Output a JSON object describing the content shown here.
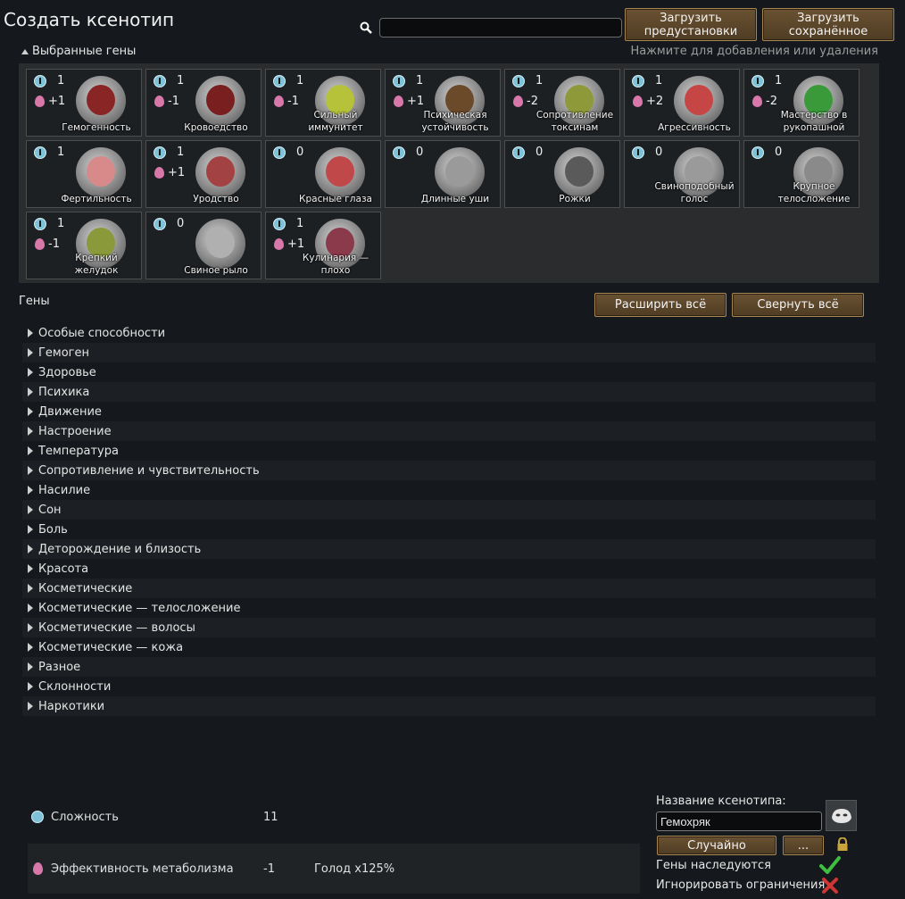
{
  "title": "Создать ксенотип",
  "search": {
    "value": ""
  },
  "buttons": {
    "load_presets": "Загрузить\nпредустановки",
    "load_saved": "Загрузить\nсохранённое",
    "expand_all": "Расширить всё",
    "collapse_all": "Свернуть всё",
    "random": "Случайно",
    "more": "..."
  },
  "selected": {
    "header": "Выбранные гены",
    "hint": "Нажмите для добавления или удаления",
    "genes": [
      {
        "label": "Гемогенность",
        "complexity": "1",
        "metabolism": "+1",
        "color": "#8a2525"
      },
      {
        "label": "Кровоедство",
        "complexity": "1",
        "metabolism": "-1",
        "color": "#7a1f1f"
      },
      {
        "label": "Сильный иммунитет",
        "complexity": "1",
        "metabolism": "-1",
        "color": "#b5c23a"
      },
      {
        "label": "Психическая устойчивость",
        "complexity": "1",
        "metabolism": "+1",
        "color": "#6b4a2a"
      },
      {
        "label": "Сопротивление токсинам",
        "complexity": "1",
        "metabolism": "-2",
        "color": "#8e9a3a"
      },
      {
        "label": "Агрессивность",
        "complexity": "1",
        "metabolism": "+2",
        "color": "#c64545"
      },
      {
        "label": "Мастерство в рукопашной",
        "complexity": "1",
        "metabolism": "-2",
        "color": "#3a9a3a"
      },
      {
        "label": "Фертильность",
        "complexity": "1",
        "metabolism": "",
        "color": "#d88a8a"
      },
      {
        "label": "Уродство",
        "complexity": "1",
        "metabolism": "+1",
        "color": "#a34242"
      },
      {
        "label": "Красные глаза",
        "complexity": "0",
        "metabolism": "",
        "color": "#c04848"
      },
      {
        "label": "Длинные уши",
        "complexity": "0",
        "metabolism": "",
        "color": "#9a9a9a"
      },
      {
        "label": "Рожки",
        "complexity": "0",
        "metabolism": "",
        "color": "#5a5a5a"
      },
      {
        "label": "Свиноподобный голос",
        "complexity": "0",
        "metabolism": "",
        "color": "#9a9a9a"
      },
      {
        "label": "Крупное телосложение",
        "complexity": "0",
        "metabolism": "",
        "color": "#8a8a8a"
      },
      {
        "label": "Крепкий желудок",
        "complexity": "1",
        "metabolism": "-1",
        "color": "#8a9a3a"
      },
      {
        "label": "Свиное рыло",
        "complexity": "0",
        "metabolism": "",
        "color": "#b0b0b0"
      },
      {
        "label": "Кулинария — плохо",
        "complexity": "1",
        "metabolism": "+1",
        "color": "#8a3a4a"
      }
    ]
  },
  "genes_section": {
    "title": "Гены",
    "categories": [
      "Особые способности",
      "Гемоген",
      "Здоровье",
      "Психика",
      "Движение",
      "Настроение",
      "Температура",
      "Сопротивление и чувствительность",
      "Насилие",
      "Сон",
      "Боль",
      "Деторождение и близость",
      "Красота",
      "Косметические",
      "Косметические — телосложение",
      "Косметические — волосы",
      "Косметические — кожа",
      "Разное",
      "Склонности",
      "Наркотики"
    ]
  },
  "stats": {
    "complexity": {
      "name": "Сложность",
      "value": "11"
    },
    "metabolism": {
      "name": "Эффективность метаболизма",
      "value": "-1",
      "extra": "Голод x125%"
    }
  },
  "xenotype": {
    "name_label": "Название ксенотипа:",
    "name_value": "Гемохряк",
    "inherit_label": "Гены наследуются",
    "inherit": true,
    "ignore_label": "Игнорировать ограничения",
    "ignore": false
  },
  "colors": {
    "complexity_icon": "#7ec2d8",
    "metabolism_icon": "#d877a9",
    "button_border": "#a78654",
    "check_green": "#3fbf3f",
    "cross_red": "#d03535"
  }
}
